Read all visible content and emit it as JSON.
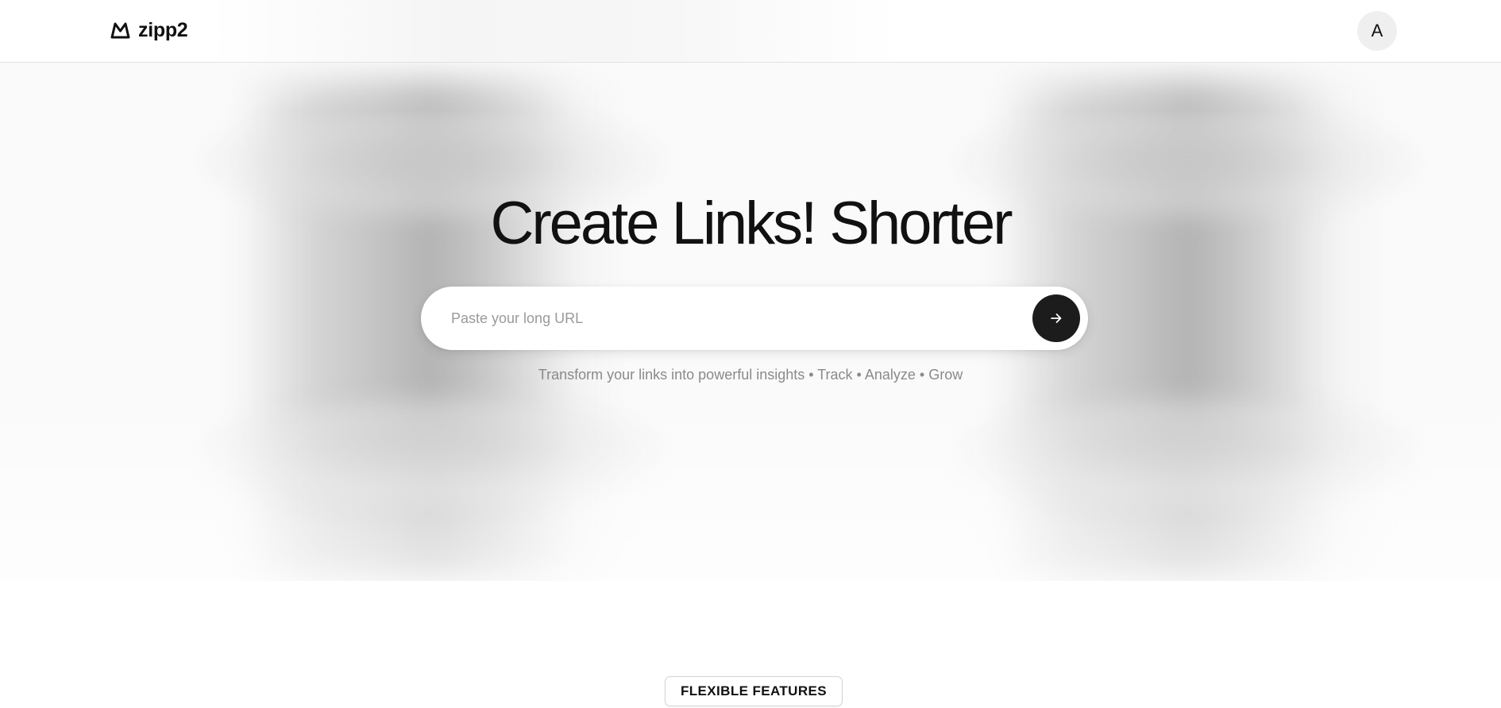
{
  "header": {
    "brand_name": "zipp2",
    "brand_icon": "mountain-logo-icon",
    "avatar_initial": "A"
  },
  "hero": {
    "headline": "Create Links! Shorter",
    "url_input": {
      "placeholder": "Paste your long URL",
      "value": ""
    },
    "submit_icon": "arrow-right-icon",
    "tagline": "Transform your links into powerful insights • Track • Analyze • Grow"
  },
  "features": {
    "badge_label": "FLEXIBLE FEATURES"
  },
  "colors": {
    "text": "#111111",
    "button_bg": "#1c1c1c",
    "muted_text": "#8a8a8a",
    "page_bg": "#ffffff"
  }
}
